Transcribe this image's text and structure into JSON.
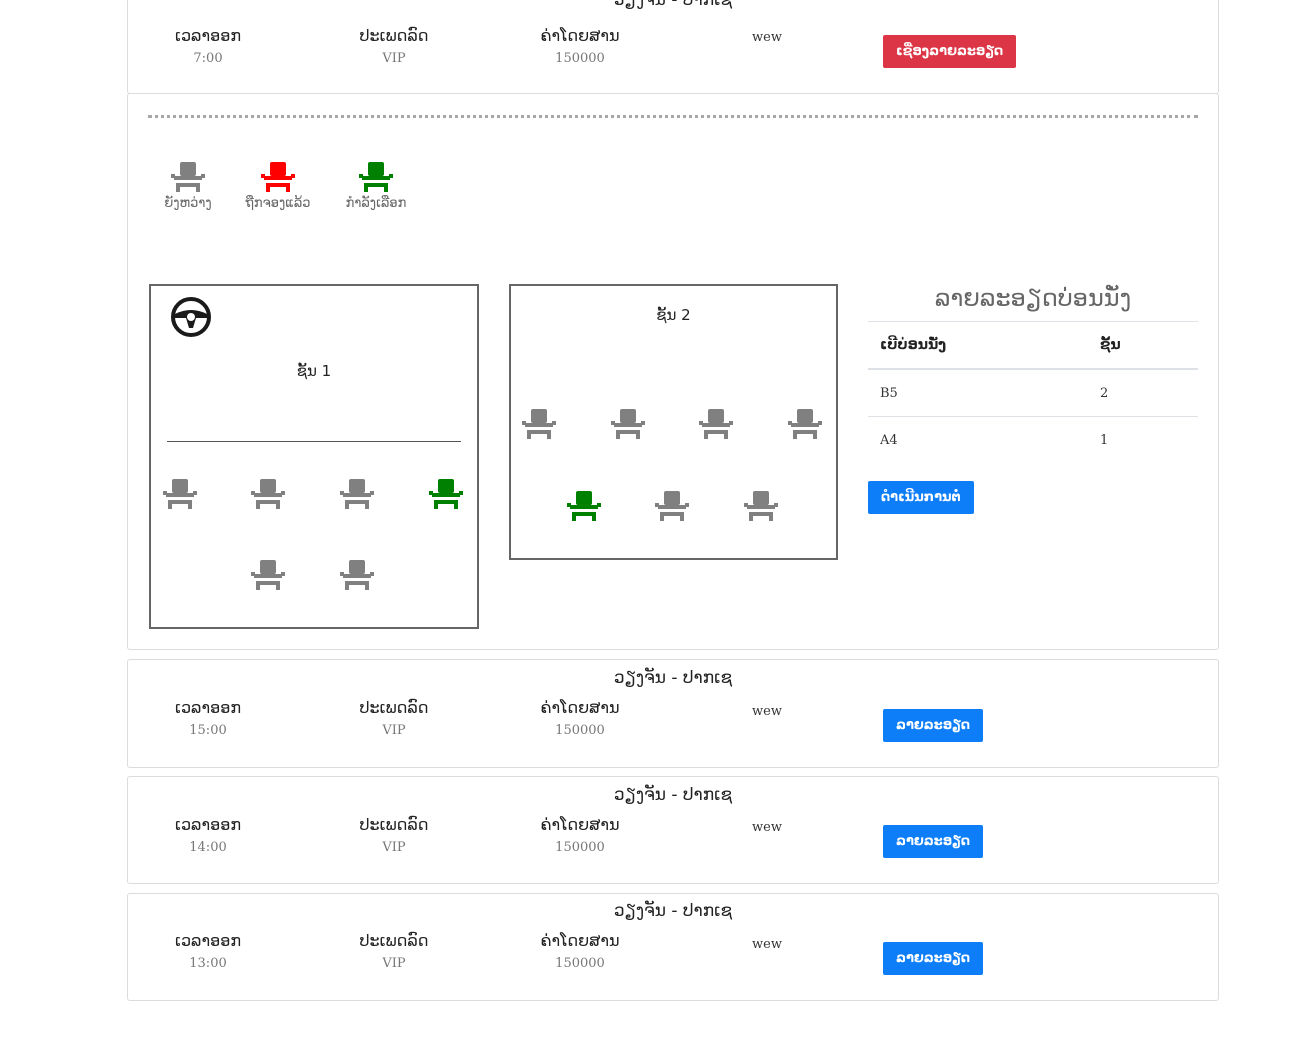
{
  "trips": [
    {
      "route": "ວຽງຈັນ - ປາກເຊ",
      "time_header": "ເວລາອອກ",
      "time": "7:00",
      "type_header": "ປະເພດລົດ",
      "type": "VIP",
      "price_header": "ຄ່າໂດຍສານ",
      "price": "150000",
      "note": "wew",
      "button": "ເຊື່ອງລາຍລະອຽດ"
    },
    {
      "route": "ວຽງຈັນ - ປາກເຊ",
      "time_header": "ເວລາອອກ",
      "time": "15:00",
      "type_header": "ປະເພດລົດ",
      "type": "VIP",
      "price_header": "ຄ່າໂດຍສານ",
      "price": "150000",
      "note": "wew",
      "button": "ລາຍລະອຽດ"
    },
    {
      "route": "ວຽງຈັນ - ປາກເຊ",
      "time_header": "ເວລາອອກ",
      "time": "14:00",
      "type_header": "ປະເພດລົດ",
      "type": "VIP",
      "price_header": "ຄ່າໂດຍສານ",
      "price": "150000",
      "note": "wew",
      "button": "ລາຍລະອຽດ"
    },
    {
      "route": "ວຽງຈັນ - ປາກເຊ",
      "time_header": "ເວລາອອກ",
      "time": "13:00",
      "type_header": "ປະເພດລົດ",
      "type": "VIP",
      "price_header": "ຄ່າໂດຍສານ",
      "price": "150000",
      "note": "wew",
      "button": "ລາຍລະອຽດ"
    }
  ],
  "legend": [
    {
      "label": "ຍັງຫວ່າງ",
      "color": "#808080",
      "icon": "seat-icon"
    },
    {
      "label": "ຖືກຈອງແລ້ວ",
      "color": "#ff0000",
      "icon": "seat-icon"
    },
    {
      "label": "ກຳລັງເລືອກ",
      "color": "#008000",
      "icon": "seat-icon"
    }
  ],
  "colors": {
    "available": "#808080",
    "booked": "#ff0000",
    "selected": "#008000",
    "primary": "#0d7ef7",
    "danger": "#dc3545"
  },
  "deck1": {
    "title": "ຊັ້ນ 1",
    "icon": "steering-wheel-icon",
    "row1": [
      "available",
      "available",
      "available",
      "selected"
    ],
    "row2": [
      "available",
      "available"
    ]
  },
  "deck2": {
    "title": "ຊັ້ນ 2",
    "row1": [
      "available",
      "available",
      "available",
      "available"
    ],
    "row2": [
      "selected",
      "available",
      "available"
    ]
  },
  "summary": {
    "title": "ລາຍລະອຽດບ່ອນນັ່ງ",
    "headers": [
      "ເບີບ່ອນນັ່ງ",
      "ຊັ້ນ"
    ],
    "rows": [
      [
        "B5",
        "2"
      ],
      [
        "A4",
        "1"
      ]
    ],
    "continue_button": "ດຳເນີນການຕໍ່"
  }
}
